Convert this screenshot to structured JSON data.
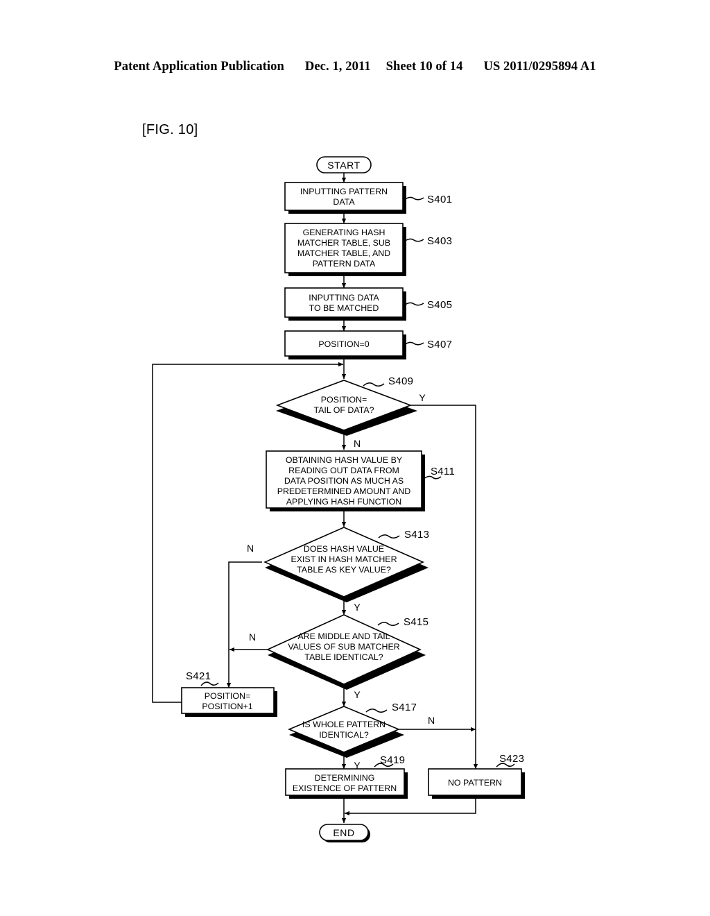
{
  "header": {
    "publication": "Patent Application Publication",
    "date": "Dec. 1, 2011",
    "sheet": "Sheet 10 of 14",
    "patent_number": "US 2011/0295894 A1"
  },
  "figure": {
    "label": "[FIG. 10]"
  },
  "flowchart": {
    "start_label": "START",
    "end_label": "END",
    "nodes": [
      {
        "id": "S401",
        "step": "S401",
        "shape": "process",
        "lines": [
          "INPUTTING PATTERN",
          "DATA"
        ]
      },
      {
        "id": "S403",
        "step": "S403",
        "shape": "process",
        "lines": [
          "GENERATING HASH",
          "MATCHER TABLE, SUB",
          "MATCHER TABLE, AND",
          "PATTERN DATA"
        ]
      },
      {
        "id": "S405",
        "step": "S405",
        "shape": "process",
        "lines": [
          "INPUTTING DATA",
          "TO BE MATCHED"
        ]
      },
      {
        "id": "S407",
        "step": "S407",
        "shape": "process",
        "lines": [
          "POSITION=0"
        ]
      },
      {
        "id": "S409",
        "step": "S409",
        "shape": "decision",
        "lines": [
          "POSITION=",
          "TAIL OF DATA?"
        ],
        "yes": "Y",
        "no": "N"
      },
      {
        "id": "S411",
        "step": "S411",
        "shape": "process",
        "lines": [
          "OBTAINING HASH VALUE BY",
          "READING OUT DATA FROM",
          "DATA POSITION AS MUCH AS",
          "PREDETERMINED AMOUNT AND",
          "APPLYING HASH FUNCTION"
        ]
      },
      {
        "id": "S413",
        "step": "S413",
        "shape": "decision",
        "lines": [
          "DOES HASH VALUE",
          "EXIST IN HASH MATCHER",
          "TABLE AS KEY VALUE?"
        ],
        "yes": "Y",
        "no": "N"
      },
      {
        "id": "S415",
        "step": "S415",
        "shape": "decision",
        "lines": [
          "ARE MIDDLE AND TAIL",
          "VALUES OF SUB MATCHER",
          "TABLE IDENTICAL?"
        ],
        "yes": "Y",
        "no": "N"
      },
      {
        "id": "S417",
        "step": "S417",
        "shape": "decision",
        "lines": [
          "IS WHOLE PATTERN",
          "IDENTICAL?"
        ],
        "yes": "Y",
        "no": "N"
      },
      {
        "id": "S419",
        "step": "S419",
        "shape": "process",
        "lines": [
          "DETERMINING",
          "EXISTENCE OF PATTERN"
        ]
      },
      {
        "id": "S421",
        "step": "S421",
        "shape": "process",
        "lines": [
          "POSITION=",
          "POSITION+1"
        ]
      },
      {
        "id": "S423",
        "step": "S423",
        "shape": "process",
        "lines": [
          "NO PATTERN"
        ]
      }
    ]
  },
  "text": {
    "n1_lines": [
      "INPUTTING PATTERN",
      "DATA"
    ],
    "n1_step": "S401",
    "n2_l1": "GENERATING HASH",
    "n2_l2": "MATCHER TABLE, SUB",
    "n2_l3": "MATCHER TABLE, AND",
    "n2_l4": "PATTERN DATA",
    "n2_step": "S403",
    "n3_l1": "INPUTTING DATA",
    "n3_l2": "TO BE MATCHED",
    "n3_step": "S405",
    "n4_l1": "POSITION=0",
    "n4_step": "S407",
    "n5_l1": "POSITION=",
    "n5_l2": "TAIL OF DATA?",
    "n5_step": "S409",
    "n5_y": "Y",
    "n5_n": "N",
    "n6_l1": "OBTAINING HASH VALUE BY",
    "n6_l2": "READING OUT DATA FROM",
    "n6_l3": "DATA POSITION AS MUCH AS",
    "n6_l4": "PREDETERMINED AMOUNT AND",
    "n6_l5": "APPLYING HASH FUNCTION",
    "n6_step": "S411",
    "n7_l1": "DOES HASH VALUE",
    "n7_l2": "EXIST IN HASH MATCHER",
    "n7_l3": "TABLE AS KEY VALUE?",
    "n7_step": "S413",
    "n7_y": "Y",
    "n7_n": "N",
    "n8_l1": "ARE MIDDLE AND TAIL",
    "n8_l2": "VALUES OF SUB MATCHER",
    "n8_l3": "TABLE IDENTICAL?",
    "n8_step": "S415",
    "n8_y": "Y",
    "n8_n": "N",
    "n9_l1": "IS WHOLE PATTERN",
    "n9_l2": "IDENTICAL?",
    "n9_step": "S417",
    "n9_y": "Y",
    "n9_n": "N",
    "n10_l1": "DETERMINING",
    "n10_l2": "EXISTENCE OF PATTERN",
    "n10_step": "S419",
    "n11_l1": "POSITION=",
    "n11_l2": "POSITION+1",
    "n11_step": "S421",
    "n12_l1": "NO PATTERN",
    "n12_step": "S423",
    "start": "START",
    "end": "END"
  },
  "colors": {
    "ink": "#000000",
    "paper": "#ffffff"
  }
}
